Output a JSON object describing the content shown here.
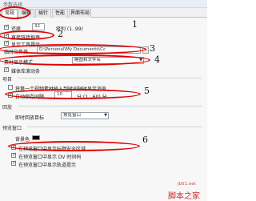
{
  "window": {
    "title": "参数选择"
  },
  "tabs": [
    "常规",
    "编辑",
    "插针",
    "性能",
    "界面布局"
  ],
  "general": {
    "undo_label": "还原",
    "undo_value": "32",
    "undo_unit": "级别 (1..99)",
    "auto_scroll_label": "直接链接拖曳",
    "show_tooltip_label": "显示工具提示",
    "auto_start_label": "自动启动",
    "autosave_folder_label": "临时文件夹",
    "autosave_folder_value": "D:\\Personal\\My Documents\\Cc",
    "media_display_label": "素材显示模式",
    "media_display_value": "略图和文件名",
    "open_clips_label": "媒体库滚动条"
  },
  "project": {
    "section_label": "项目",
    "insert_label": "将第一个视频素材插入到时间轴时显示消息",
    "autosave_label": "自动保存间隔",
    "autosave_value": "10",
    "autosave_unit": "分 (1...60) 分"
  },
  "playback": {
    "section_label": "回放",
    "target_label": "即时回放目标",
    "target_value": "预览窗口"
  },
  "preview": {
    "section_label": "预览窗口",
    "background_label": "背景色",
    "safe_area_label": "在预览窗口中显示标题安全区域",
    "dv_timecode_label": "在预览窗口中显示 DV 时间码",
    "track_label": "在预览窗口中显示轨道提示"
  },
  "annotations": [
    "1",
    "2",
    "3",
    "4",
    "5",
    "6"
  ],
  "watermark": {
    "site": "jb51.net",
    "brand": "脚本之家"
  },
  "colors": {
    "annotation": "#e00000",
    "accent_tab": "#ffffff",
    "watermark": "#cc2a2a"
  }
}
